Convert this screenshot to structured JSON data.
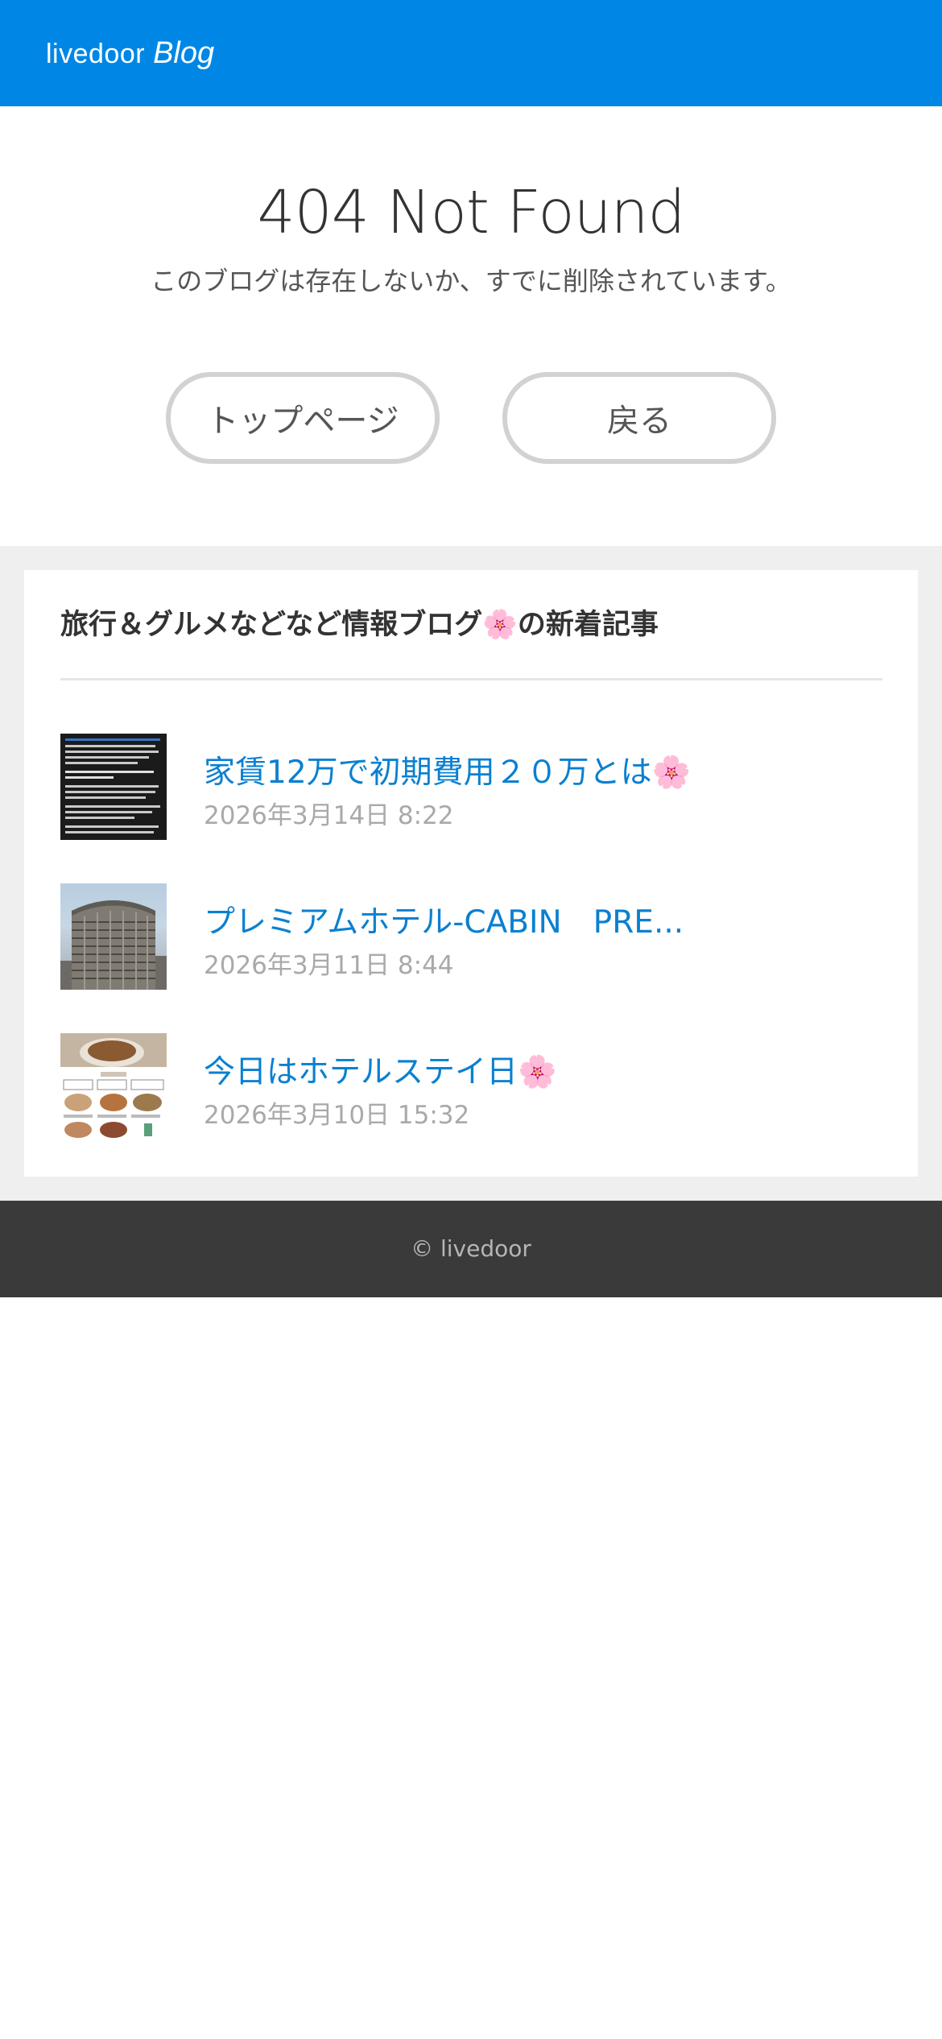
{
  "header": {
    "logo_main": "livedoor",
    "logo_sub": "Blog"
  },
  "error": {
    "title": "404 Not Found",
    "message": "このブログは存在しないか、すでに削除されています。",
    "top_button": "トップページ",
    "back_button": "戻る"
  },
  "recent": {
    "heading": "旅行＆グルメなどなど情報ブログ🌸の新着記事",
    "articles": [
      {
        "title": "家賃12万で初期費用２０万とは🌸",
        "date": "2026年3月14日 8:22",
        "thumb_icon": "document-screenshot-thumbnail"
      },
      {
        "title": "プレミアムホテル-CABIN　PRE...",
        "date": "2026年3月11日 8:44",
        "thumb_icon": "hotel-building-thumbnail"
      },
      {
        "title": "今日はホテルステイ日🌸",
        "date": "2026年3月10日 15:32",
        "thumb_icon": "food-menu-thumbnail"
      }
    ]
  },
  "footer": {
    "copyright": "© livedoor"
  },
  "colors": {
    "header_bg": "#0087e6",
    "link": "#0a80d1",
    "date": "#a9a9a9",
    "footer_bg": "#3a3a3a",
    "section_bg": "#efefef"
  }
}
